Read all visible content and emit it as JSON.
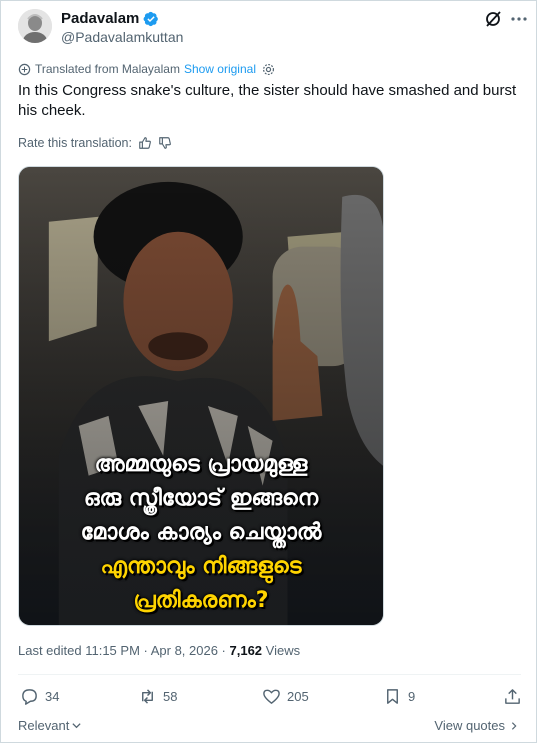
{
  "author": {
    "display_name": "Padavalam",
    "handle": "@Padavalamkuttan",
    "verified": true
  },
  "translation": {
    "notice": "Translated from Malayalam",
    "show_original": "Show original",
    "rate_label": "Rate this translation:"
  },
  "tweet": {
    "text": "In this Congress snake's culture, the sister should have smashed and burst his cheek."
  },
  "media": {
    "caption_lines_white": [
      "അമ്മയുടെ പ്രായമുള്ള",
      "ഒരു സ്ത്രീയോട് ഇങ്ങനെ",
      "മോശം കാര്യം ചെയ്താൽ"
    ],
    "caption_lines_yellow": [
      "എന്താവും നിങ്ങളുടെ",
      "പ്രതികരണം?"
    ]
  },
  "meta": {
    "edited_prefix": "Last edited 11:15 PM · Apr 8, 2026 · ",
    "views_count": "7,162",
    "views_label": " Views"
  },
  "actions": {
    "replies": "34",
    "reposts": "58",
    "likes": "205",
    "bookmarks": "9"
  },
  "footer": {
    "sort_label": "Relevant",
    "view_quotes": "View quotes"
  },
  "colors": {
    "accent": "#1d9bf0",
    "caption_yellow": "#ffd400",
    "muted": "#536471"
  }
}
